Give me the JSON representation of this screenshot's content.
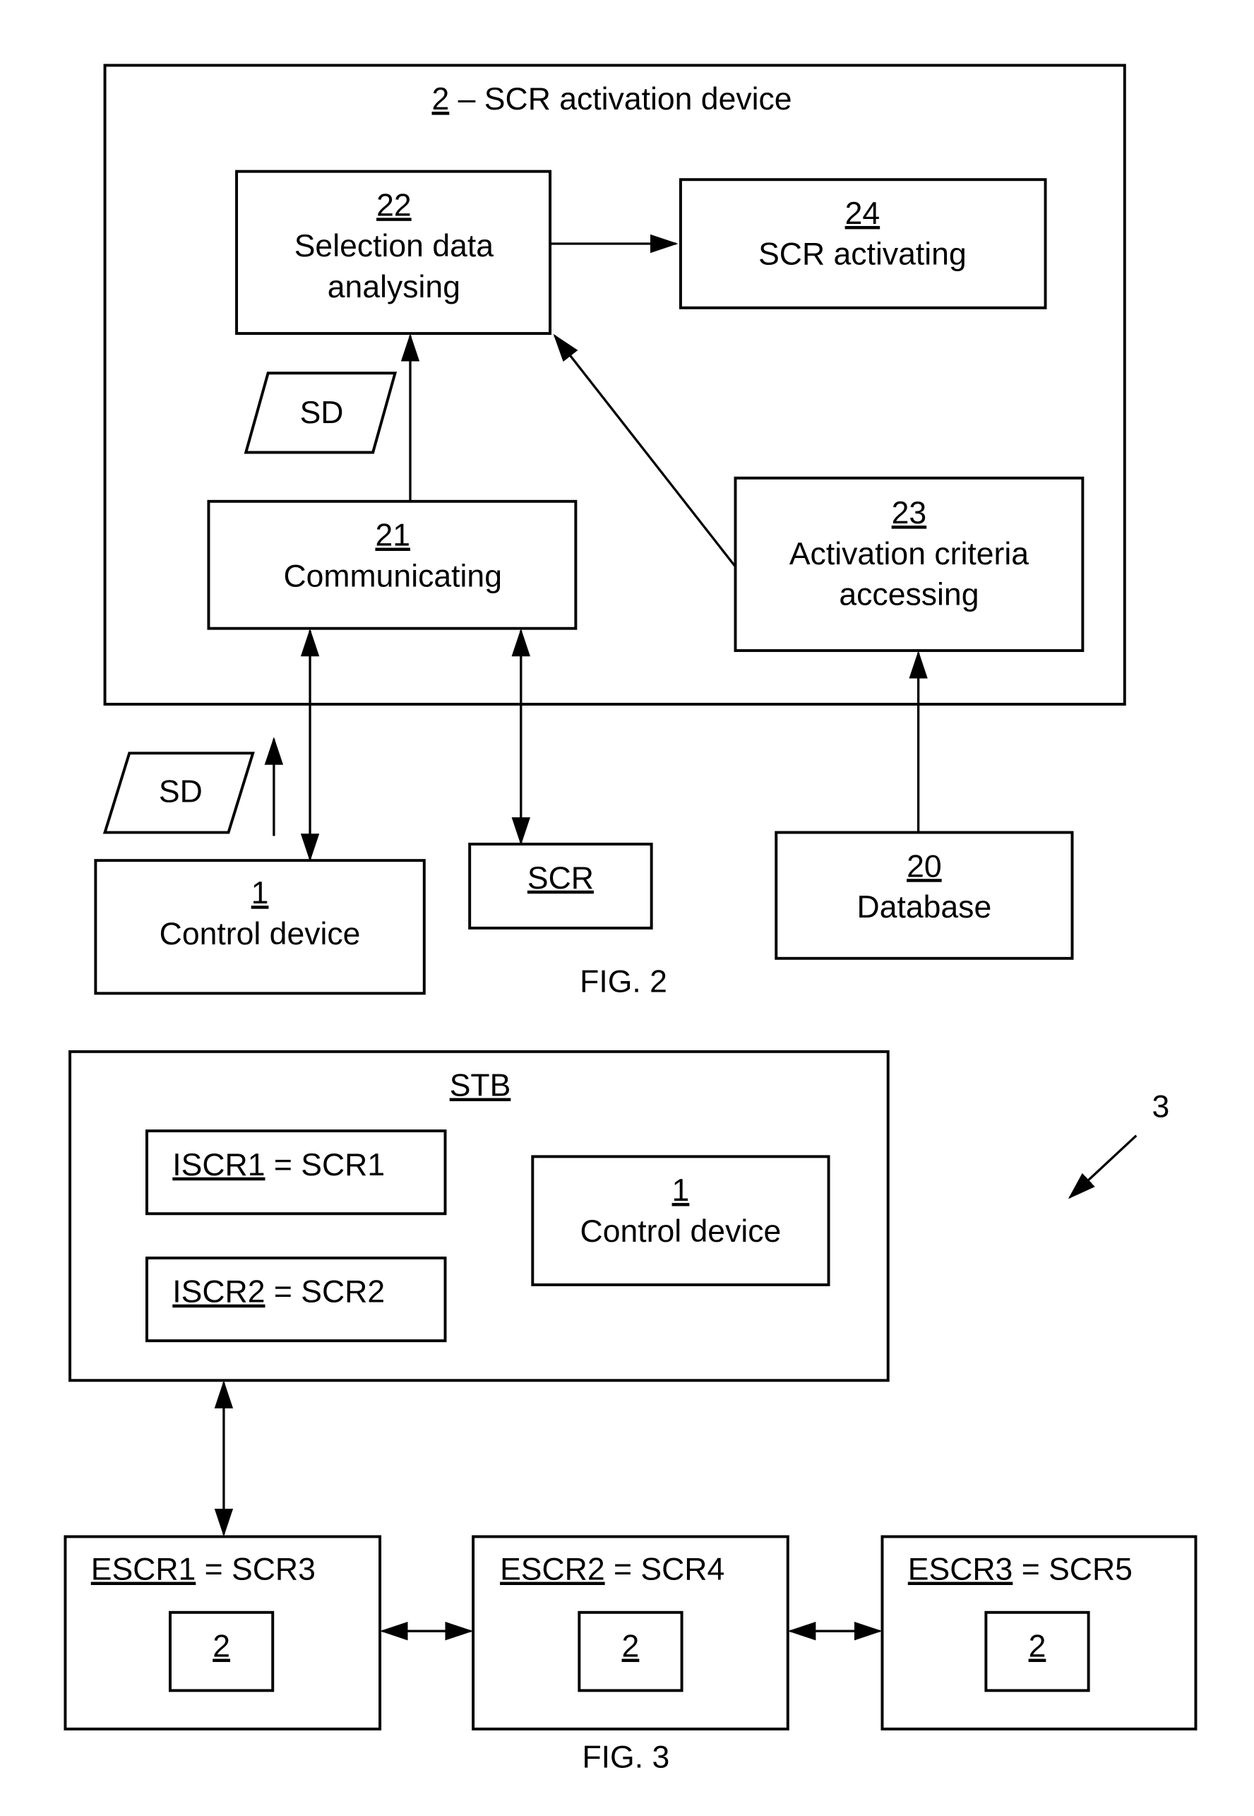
{
  "fig2": {
    "caption": "FIG. 2",
    "device": {
      "number": "2",
      "title": " – SCR activation device"
    },
    "blocks": {
      "b22": {
        "number": "22",
        "line1": "Selection data",
        "line2": "analysing"
      },
      "b24": {
        "number": "24",
        "line1": "SCR activating"
      },
      "b21": {
        "number": "21",
        "line1": "Communicating"
      },
      "b23": {
        "number": "23",
        "line1": "Activation criteria",
        "line2": "accessing"
      },
      "b1": {
        "number": "1",
        "line1": "Control device"
      },
      "scr": {
        "number": "SCR"
      },
      "b20": {
        "number": "20",
        "line1": "Database"
      }
    },
    "data_labels": {
      "sd_inner": "SD",
      "sd_outer": "SD"
    }
  },
  "fig3": {
    "caption": "FIG. 3",
    "ref_label": "3",
    "stb": {
      "title": "STB",
      "iscr1": {
        "id": "ISCR1",
        "eq": " = SCR1"
      },
      "iscr2": {
        "id": "ISCR2",
        "eq": " = SCR2"
      },
      "control": {
        "number": "1",
        "line1": "Control device"
      }
    },
    "escr": [
      {
        "id": "ESCR1",
        "eq": " = SCR3",
        "inner": "2"
      },
      {
        "id": "ESCR2",
        "eq": " = SCR4",
        "inner": "2"
      },
      {
        "id": "ESCR3",
        "eq": " = SCR5",
        "inner": "2"
      }
    ]
  }
}
